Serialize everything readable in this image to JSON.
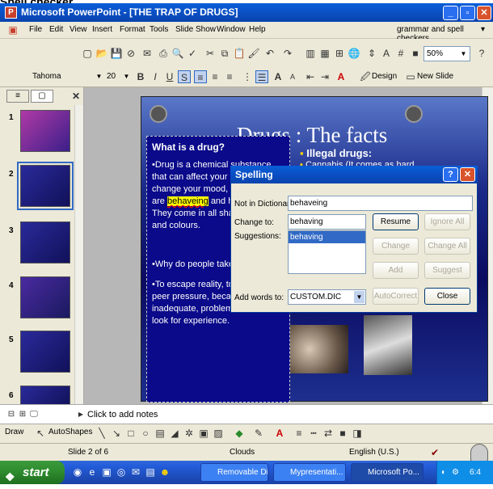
{
  "top_caption": "Spell checker",
  "window": {
    "title": "Microsoft PowerPoint - [THE TRAP OF DRUGS]",
    "min": "_",
    "max": "▫",
    "close": "✕"
  },
  "menu": {
    "items": [
      "File",
      "Edit",
      "View",
      "Insert",
      "Format",
      "Tools",
      "Slide Show",
      "Window",
      "Help"
    ],
    "help_box": "grammar and spell checkers"
  },
  "toolbar": {
    "zoom": "50%"
  },
  "format_bar": {
    "font": "Tahoma",
    "size": "20",
    "design": "Design",
    "new_slide": "New Slide"
  },
  "outline": {
    "slide_numbers": [
      "1",
      "2",
      "3",
      "4",
      "5",
      "6"
    ]
  },
  "slide": {
    "title": "Drugs : The facts",
    "box_heading": "What is a drug?",
    "para1_a": "•Drug is a chemical substance that can affect your body and change your mood, the way you are",
    "para1_hl": "behaveing",
    "para1_b": "and how you think. They come in all shapes, forms and colours.",
    "para2": "•Why do people take drugs?",
    "para3": "•To escape reality, to fill a gap, peer pressure, because they feel inadequate, problems at home, to look for experience.",
    "bullet1": "Illegal drugs:",
    "bullet2": "Cannabis (It comes as hard"
  },
  "spelling": {
    "title": "Spelling",
    "not_in_dict_label": "Not in Dictionary:",
    "not_in_dict_value": "behaveing",
    "change_to_label": "Change to:",
    "change_to_value": "behaving",
    "suggestions_label": "Suggestions:",
    "suggestions": [
      "behaving"
    ],
    "add_words_label": "Add words to:",
    "add_words_value": "CUSTOM.DIC",
    "buttons": {
      "resume": "Resume",
      "ignore_all": "Ignore All",
      "change": "Change",
      "change_all": "Change All",
      "add": "Add",
      "suggest": "Suggest",
      "autocorrect": "AutoCorrect",
      "close": "Close"
    }
  },
  "notes": {
    "placeholder": "Click to add notes"
  },
  "draw_bar": {
    "draw": "Draw",
    "autoshapes": "AutoShapes"
  },
  "status": {
    "slide": "Slide 2 of 6",
    "design": "Clouds",
    "language": "English (U.S.)"
  },
  "taskbar": {
    "start": "start",
    "tasks": [
      "Removable Di...",
      "Mypresentati...",
      "Microsoft Po..."
    ],
    "time": "6:4"
  }
}
